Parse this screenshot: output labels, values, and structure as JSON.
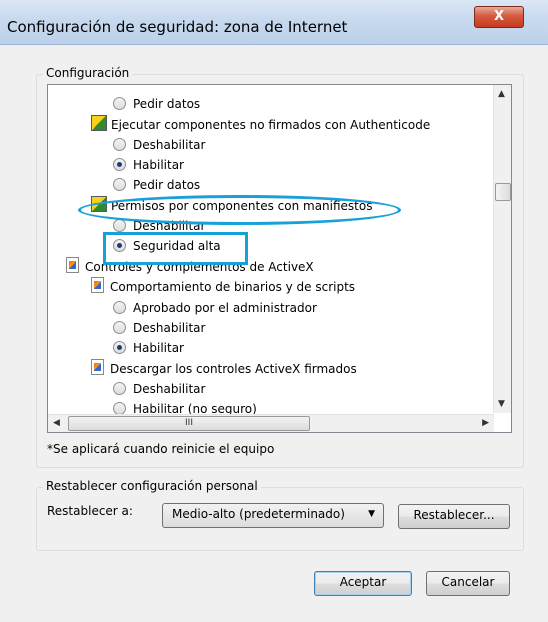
{
  "window": {
    "title": "Configuración de seguridad: zona de Internet",
    "close_label": "X"
  },
  "settings": {
    "legend": "Configuración",
    "items": [
      {
        "label": "Pedir datos",
        "type": "radio",
        "checked": false
      },
      {
        "label": "Ejecutar componentes no firmados con Authenticode",
        "type": "shield"
      },
      {
        "label": "Deshabilitar",
        "type": "radio",
        "checked": false
      },
      {
        "label": "Habilitar",
        "type": "radio",
        "checked": true
      },
      {
        "label": "Pedir datos",
        "type": "radio",
        "checked": false
      },
      {
        "label": "Permisos por componentes con manifiestos",
        "type": "shield"
      },
      {
        "label": "Deshabilitar",
        "type": "radio",
        "checked": false
      },
      {
        "label": "Seguridad alta",
        "type": "radio",
        "checked": true
      },
      {
        "label": "Controles y complementos de ActiveX",
        "type": "doc"
      },
      {
        "label": "Comportamiento de binarios y de scripts",
        "type": "doc"
      },
      {
        "label": "Aprobado por el administrador",
        "type": "radio",
        "checked": false
      },
      {
        "label": "Deshabilitar",
        "type": "radio",
        "checked": false
      },
      {
        "label": "Habilitar",
        "type": "radio",
        "checked": true
      },
      {
        "label": "Descargar los controles ActiveX firmados",
        "type": "doc"
      },
      {
        "label": "Deshabilitar",
        "type": "radio",
        "checked": false
      },
      {
        "label": "Habilitar (no seguro)",
        "type": "radio",
        "checked": false
      }
    ],
    "scroll_thumb_label": "III",
    "note": "*Se aplicará cuando reinicie el equipo"
  },
  "reset": {
    "legend": "Restablecer configuración personal",
    "label": "Restablecer a:",
    "selected": "Medio-alto (predeterminado)",
    "button": "Restablecer..."
  },
  "footer": {
    "ok": "Aceptar",
    "cancel": "Cancelar"
  },
  "colors": {
    "highlight": "#18a0d8"
  }
}
